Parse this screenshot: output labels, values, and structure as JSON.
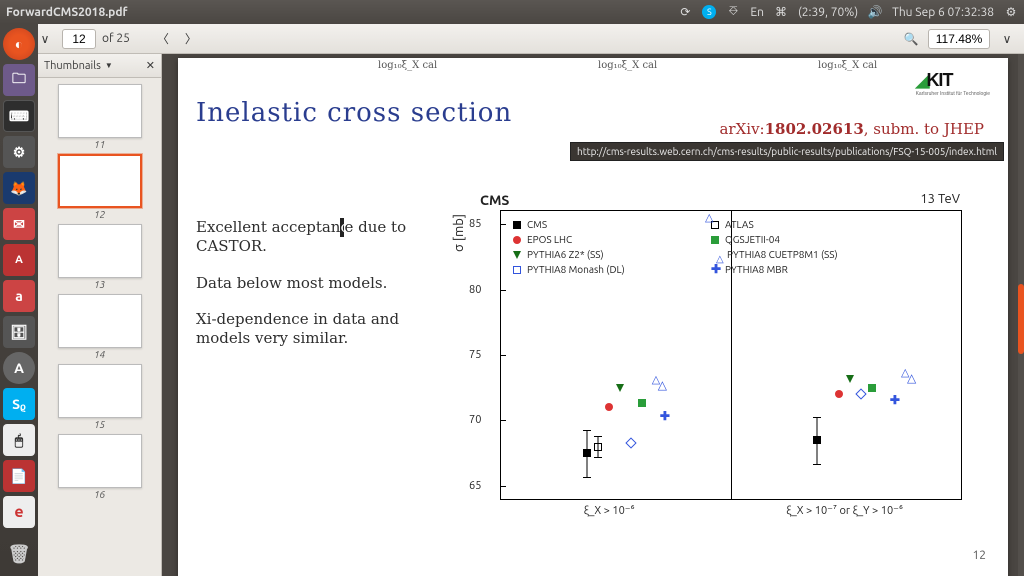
{
  "window": {
    "title": "ForwardCMS2018.pdf"
  },
  "topbar": {
    "lang": "En",
    "battery": "(2:39, 70%)",
    "clock": "Thu Sep  6 07:32:38"
  },
  "toolbar": {
    "page_current": "12",
    "page_total_label": "of 25",
    "zoom": "117.48%"
  },
  "thumbnails": {
    "header": "Thumbnails",
    "items": [
      {
        "page": 11,
        "selected": false
      },
      {
        "page": 12,
        "selected": true
      },
      {
        "page": 13,
        "selected": false
      },
      {
        "page": 14,
        "selected": false
      },
      {
        "page": 15,
        "selected": false
      },
      {
        "page": 16,
        "selected": false
      }
    ]
  },
  "slide": {
    "top_axis_label": "log₁₀ξ_X cal",
    "title": "Inelastic  cross  section",
    "logo_text": "KIT",
    "logo_sub": "Karlsruher Institut für Technologie",
    "reference": "arXiv:1802.02613, subm. to JHEP",
    "tooltip_url": "http://cms-results.web.cern.ch/cms-results/public-results/publications/FSQ-15-005/index.html",
    "body": {
      "p1": "Excellent acceptance due to CASTOR.",
      "p2": "Data below most models.",
      "p3": "Xi-dependence in data and models very similar."
    },
    "page_number": "12"
  },
  "chart_data": {
    "type": "scatter",
    "title_left": "CMS",
    "title_right": "13 TeV",
    "ylabel": "σ [mb]",
    "ylim": [
      64,
      86
    ],
    "yticks": [
      65,
      70,
      75,
      80,
      85
    ],
    "panels": [
      {
        "xlabel": "ξ_X > 10⁻⁶"
      },
      {
        "xlabel": "ξ_X > 10⁻⁷ or ξ_Y > 10⁻⁶"
      }
    ],
    "legend": [
      {
        "marker": "m-sq-fill",
        "label": "CMS"
      },
      {
        "marker": "m-circ-red",
        "label": "EPOS LHC"
      },
      {
        "marker": "m-tri-green",
        "label": "PYTHIA6 Z2* (SS)"
      },
      {
        "marker": "m-dia-blue",
        "label": "PYTHIA8 Monash (DL)"
      },
      {
        "marker": "m-sq-open",
        "label": "ATLAS"
      },
      {
        "marker": "m-sq-green",
        "label": "QGSJETII-04"
      },
      {
        "marker": "m-tri-blue",
        "label": "PYTHIA8 CUETP8M1 (SS)"
      },
      {
        "marker": "m-plus-blue",
        "label": "PYTHIA8 MBR"
      }
    ],
    "series": [
      {
        "name": "CMS",
        "marker": "m-sq-fill",
        "values": [
          67.5,
          68.5
        ],
        "err": [
          1.8,
          1.8
        ]
      },
      {
        "name": "ATLAS",
        "marker": "m-sq-open",
        "values": [
          68.0,
          null
        ],
        "err": [
          0.8,
          null
        ]
      },
      {
        "name": "EPOS LHC",
        "marker": "m-circ-red",
        "values": [
          71.0,
          72.0
        ]
      },
      {
        "name": "PYTHIA6 Z2* (SS)",
        "marker": "m-tri-green",
        "values": [
          72.5,
          73.2
        ]
      },
      {
        "name": "PYTHIA8 Monash (DL)",
        "marker": "m-dia-blue",
        "values": [
          68.3,
          72.0
        ]
      },
      {
        "name": "QGSJETII-04",
        "marker": "m-sq-green",
        "values": [
          71.3,
          72.5
        ]
      },
      {
        "name": "PYTHIA8 CUETP8M1 (SS)",
        "marker": "m-tri-blue",
        "values": [
          73.5,
          74.0
        ]
      },
      {
        "name": "PYTHIA8 MBR",
        "marker": "m-plus-blue",
        "values": [
          70.3,
          71.5
        ]
      }
    ]
  }
}
